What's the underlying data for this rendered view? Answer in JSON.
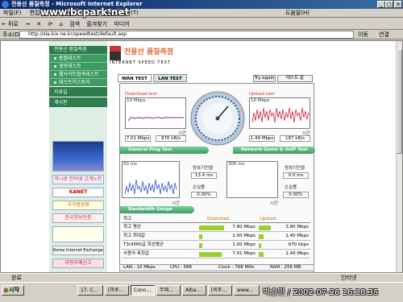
{
  "window": {
    "title": "전용선 품질측정 - Microsoft Internet Explorer",
    "watermark": "www.bcpark.net"
  },
  "menu": {
    "items": [
      "파일(F)",
      "편집(E)",
      "보기(V)",
      "즐겨찾기(A)",
      "도구(T)"
    ],
    "help": "도움말(H)"
  },
  "toolbar": {
    "back": "← 뒤로",
    "forward": "→",
    "stop": "✕",
    "refresh": "⟳",
    "home": "⌂",
    "search": "검색",
    "favorites": "즐겨찾기",
    "media": "미디어"
  },
  "address": {
    "label": "주소(D)",
    "url": "http://sla.kix.ne.kr/speedtest/default.asp",
    "go": "이동",
    "links": "연결"
  },
  "sidebar": {
    "header": "전용선 품질측정",
    "items": [
      {
        "label": "품질테스트"
      },
      {
        "label": "경로테스트"
      },
      {
        "label": "웹사이트접속테스트"
      },
      {
        "label": "테스트히스토리"
      }
    ],
    "sections": [
      {
        "label": "자료실"
      },
      {
        "label": "게시판"
      }
    ],
    "ads": [
      "하나로 인터넷 고객노트",
      "KANET",
      "국가정보원",
      "한국정보인증",
      "Korea Internet Exchange",
      "부정부패신고"
    ]
  },
  "main": {
    "brand": "전용선 품질측정",
    "brand_sub": "INTERNET SPEED TEST",
    "tabs": [
      {
        "label": "WAN TEST"
      },
      {
        "label": "LAN TEST"
      }
    ],
    "try_again": "Try again",
    "mode": "테스트 끝",
    "download": {
      "title": "Download test",
      "scale": "10 Mbps",
      "axis": "시간",
      "speed_mbps": "7.01 Mbps",
      "speed_kbps": "876 kB/s"
    },
    "upload": {
      "title": "Upload test",
      "scale": "10 Mbps",
      "axis": "시간",
      "speed_mbps": "1.49 Mbps",
      "speed_kbps": "187 kB/s"
    },
    "ping": {
      "title": "General Ping Test",
      "scale": "50 ms",
      "axis": "시간",
      "rtt_label": "왕복지연율",
      "rtt": "13.4 ms",
      "loss_label": "손실률",
      "loss": "0.00%"
    },
    "game": {
      "title": "Network Game & VoIP Test",
      "scale": "300 ms",
      "axis": "시간",
      "rtt_label": "왕복지연율",
      "rtt": "0.0 ms",
      "loss_label": "손실률",
      "loss": "0.00%"
    },
    "bandwidth": {
      "title": "Bandwidth Gauge",
      "head_item": "최고",
      "head_down": "Download",
      "head_up": "Upload",
      "rows": [
        {
          "label": "최고 평균",
          "down": "7.80 Mbps",
          "up": "3.80 Mbps",
          "down_frac": 0.78,
          "up_frac": 0.38
        },
        {
          "label": "최고 최대값",
          "down": "1.00 Mbps",
          "up": "1.40 Mbps",
          "down_frac": 0.1,
          "up_frac": 0.14
        },
        {
          "label": "T3(45M)급 회선평균",
          "down": "1.00 Mbps",
          "up": "670 kbps",
          "down_frac": 0.1,
          "up_frac": 0.07
        },
        {
          "label": "사용자 측정값",
          "down": "7.01 Mbps",
          "up": "1.49 Mbps",
          "down_frac": 0.7,
          "up_frac": 0.15
        }
      ]
    },
    "info": {
      "lan": "LAN : 10 Mbps",
      "cpu": "CPU : 586",
      "clock": "Clock : 768 MHz",
      "ram": "RAM : 256 MB"
    }
  },
  "status": {
    "left": "완료",
    "zone": "인터넷"
  },
  "taskbar": {
    "start": "시작",
    "tasks": [
      {
        "label": "17. C..."
      },
      {
        "label": "[미루..."
      },
      {
        "label": "Conn..."
      },
      {
        "label": "무제..."
      },
      {
        "label": "Alba..."
      },
      {
        "label": "[비주..."
      },
      {
        "label": "www..."
      }
    ],
    "signature": "박승민 / 2002-07-26 16:18:35"
  },
  "chart_colors": {
    "download_line": "#7a2a8a",
    "upload_line": "#cc2233",
    "ping_line": "#3355cc"
  }
}
